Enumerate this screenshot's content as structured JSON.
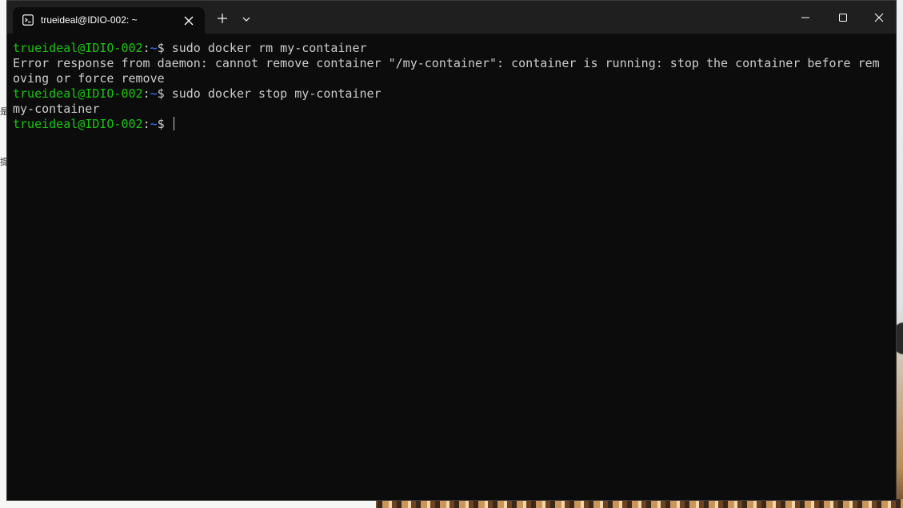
{
  "window": {
    "tab_title": "trueideal@IDIO-002: ~",
    "tab_icon": "terminal-icon",
    "controls": [
      "new-tab-icon",
      "chevron-down-icon",
      "minimize-icon",
      "maximize-icon",
      "close-icon"
    ]
  },
  "terminal": {
    "colors": {
      "background": "#0c0c0c",
      "text": "#cccccc",
      "user_host": "#16c60c",
      "path": "#3b78ff"
    },
    "lines": [
      {
        "user_host": "trueideal@IDIO-002",
        "sep": ":",
        "path": "~",
        "prompt": "$ ",
        "command": "sudo docker rm my-container"
      },
      {
        "output": "Error response from daemon: cannot remove container \"/my-container\": container is running: stop the container before rem"
      },
      {
        "output": "oving or force remove"
      },
      {
        "user_host": "trueideal@IDIO-002",
        "sep": ":",
        "path": "~",
        "prompt": "$ ",
        "command": "sudo docker stop my-container"
      },
      {
        "output": "my-container"
      },
      {
        "user_host": "trueideal@IDIO-002",
        "sep": ":",
        "path": "~",
        "prompt": "$ ",
        "command": ""
      }
    ]
  },
  "background": {
    "glyph_1": "是",
    "glyph_2": "提"
  }
}
